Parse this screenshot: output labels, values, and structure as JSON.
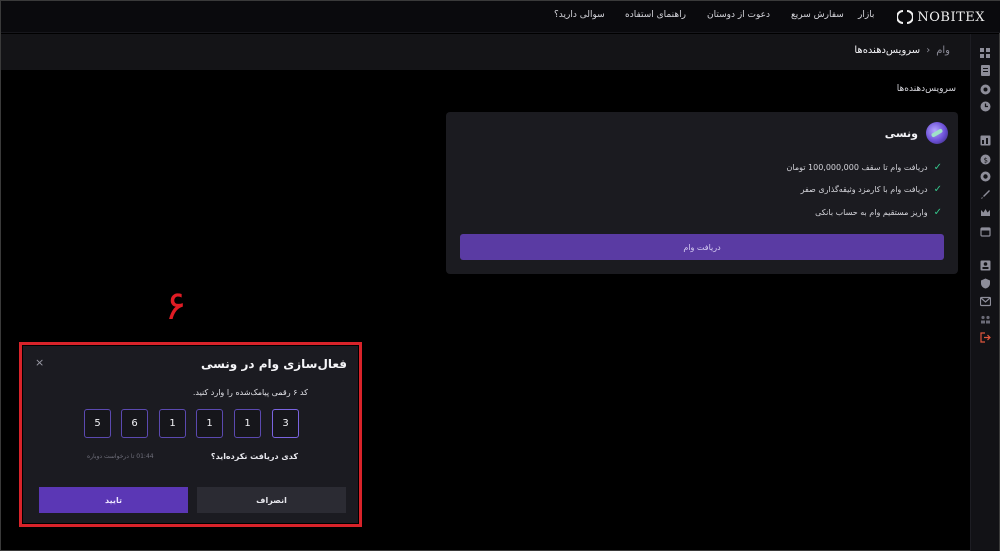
{
  "navbar": {
    "logo_text": "NOBITEX",
    "items": [
      "بازار",
      "سفارش سریع",
      "دعوت از دوستان",
      "راهنمای استفاده",
      "سوالی دارید؟"
    ]
  },
  "breadcrumb": {
    "home": "وام",
    "separator": "‹",
    "current": "سرویس‌دهنده‌ها"
  },
  "section_title": "سرویس‌دهنده‌ها",
  "provider_card": {
    "name": "ونسی",
    "features": [
      "دریافت وام تا سقف 100,000,000 تومان",
      "دریافت وام با کارمزد وثیقه‌گذاری صفر",
      "واریز مستقیم وام به حساب بانکی"
    ],
    "button_label": "دریافت وام"
  },
  "annotation": {
    "step_number": "۶"
  },
  "modal": {
    "title": "فعال‌سازی وام در ونسی",
    "close_symbol": "×",
    "instruction": "کد ۶ رقمی پیامک‌شده را وارد کنید.",
    "digits": [
      "3",
      "1",
      "1",
      "1",
      "6",
      "5"
    ],
    "resend_question": "کدی دریافت نکرده‌اید؟",
    "resend_timer": "01:44 تا درخواست دوباره",
    "cancel_label": "انصراف",
    "confirm_label": "تایید"
  },
  "colors": {
    "accent_purple": "#5b37b5",
    "annotation_red": "#d8232a",
    "check_green": "#35c48a"
  },
  "icons": {
    "rail": [
      "dashboard-icon",
      "orders-icon",
      "wallet-icon",
      "history-icon",
      "market-icon",
      "earn-icon",
      "loan-icon",
      "rocket-icon",
      "crown-icon",
      "calendar-icon",
      "profile-icon",
      "security-icon",
      "messages-icon",
      "referral-icon",
      "logout-icon"
    ]
  }
}
